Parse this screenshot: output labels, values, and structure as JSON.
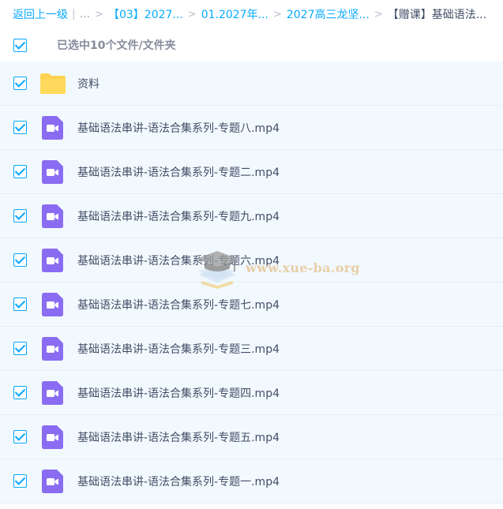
{
  "breadcrumb": {
    "back_label": "返回上一级",
    "separator": "|",
    "ellipsis": "...",
    "arrow": ">",
    "crumbs": [
      "【03】2027...",
      "01.2027年...",
      "2027高三龙坚..."
    ],
    "current": "【赠课】基础语法..."
  },
  "selection": {
    "label": "已选中10个文件/文件夹"
  },
  "files": [
    {
      "name": "资料",
      "type": "folder"
    },
    {
      "name": "基础语法串讲-语法合集系列-专题八.mp4",
      "type": "video"
    },
    {
      "name": "基础语法串讲-语法合集系列-专题二.mp4",
      "type": "video"
    },
    {
      "name": "基础语法串讲-语法合集系列-专题九.mp4",
      "type": "video"
    },
    {
      "name": "基础语法串讲-语法合集系列-专题六.mp4",
      "type": "video"
    },
    {
      "name": "基础语法串讲-语法合集系列-专题七.mp4",
      "type": "video"
    },
    {
      "name": "基础语法串讲-语法合集系列-专题三.mp4",
      "type": "video"
    },
    {
      "name": "基础语法串讲-语法合集系列-专题四.mp4",
      "type": "video"
    },
    {
      "name": "基础语法串讲-语法合集系列-专题五.mp4",
      "type": "video"
    },
    {
      "name": "基础语法串讲-语法合集系列-专题一.mp4",
      "type": "video"
    }
  ],
  "watermark": {
    "text": "www.xue-ba.org"
  },
  "colors": {
    "accent": "#06a7ff",
    "link": "#09aaff",
    "row_background": "#f2f9fe",
    "folder": "#fdd250",
    "video_icon": "#8a6cf2"
  }
}
